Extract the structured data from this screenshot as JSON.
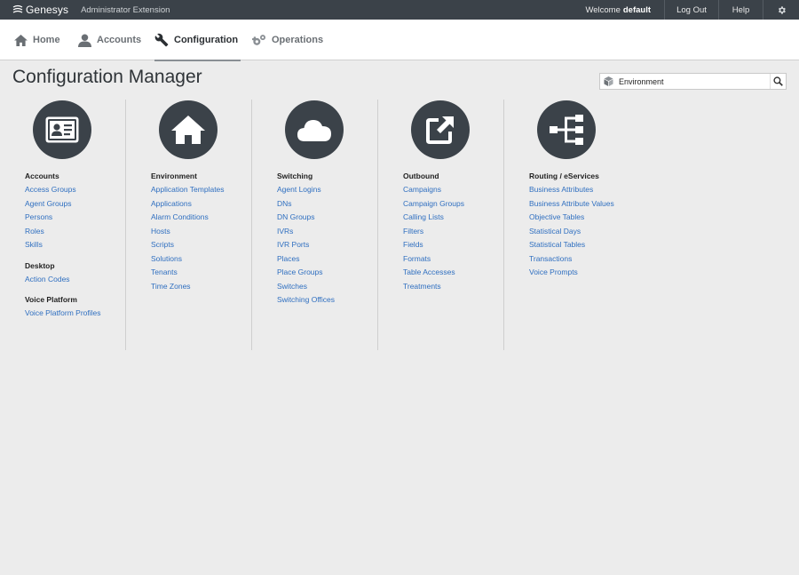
{
  "topbar": {
    "brand": "Genesys",
    "app_name": "Administrator Extension",
    "welcome_prefix": "Welcome",
    "user": "default",
    "logout": "Log Out",
    "help": "Help"
  },
  "nav": {
    "home": "Home",
    "accounts": "Accounts",
    "configuration": "Configuration",
    "operations": "Operations"
  },
  "page_title": "Configuration Manager",
  "search": {
    "value": "Environment"
  },
  "columns": [
    {
      "icon": "contact-card-icon",
      "groups": [
        {
          "title": "Accounts",
          "links": [
            "Access Groups",
            "Agent Groups",
            "Persons",
            "Roles",
            "Skills"
          ]
        },
        {
          "title": "Desktop",
          "links": [
            "Action Codes"
          ]
        },
        {
          "title": "Voice Platform",
          "links": [
            "Voice Platform Profiles"
          ]
        }
      ]
    },
    {
      "icon": "house-icon",
      "groups": [
        {
          "title": "Environment",
          "links": [
            "Application Templates",
            "Applications",
            "Alarm Conditions",
            "Hosts",
            "Scripts",
            "Solutions",
            "Tenants",
            "Time Zones"
          ]
        }
      ]
    },
    {
      "icon": "cloud-icon",
      "groups": [
        {
          "title": "Switching",
          "links": [
            "Agent Logins",
            "DNs",
            "DN Groups",
            "IVRs",
            "IVR Ports",
            "Places",
            "Place Groups",
            "Switches",
            "Switching Offices"
          ]
        }
      ]
    },
    {
      "icon": "external-link-icon",
      "groups": [
        {
          "title": "Outbound",
          "links": [
            "Campaigns",
            "Campaign Groups",
            "Calling Lists",
            "Filters",
            "Fields",
            "Formats",
            "Table Accesses",
            "Treatments"
          ]
        }
      ]
    },
    {
      "icon": "routing-tree-icon",
      "groups": [
        {
          "title": "Routing / eServices",
          "links": [
            "Business Attributes",
            "Business Attribute Values",
            "Objective Tables",
            "Statistical Days",
            "Statistical Tables",
            "Transactions",
            "Voice Prompts"
          ]
        }
      ]
    }
  ],
  "colors": {
    "topbar": "#3b4249",
    "link": "#2f6fc0",
    "background": "#ececec"
  }
}
